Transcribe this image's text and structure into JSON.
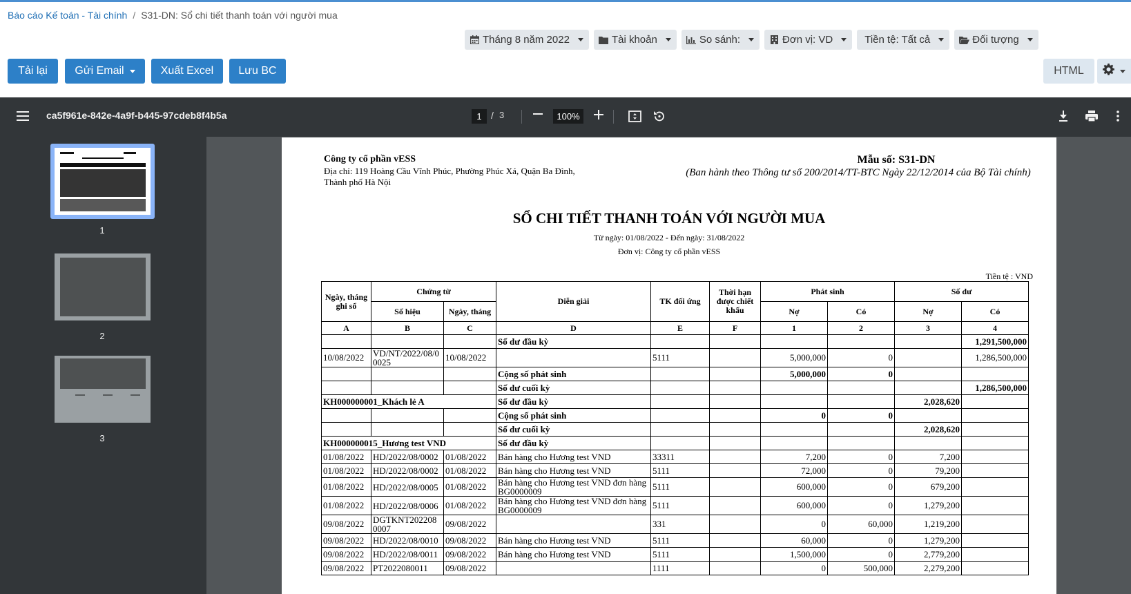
{
  "breadcrumb": {
    "parent": "Báo cáo Kế toán - Tài chính",
    "separator": "/",
    "current": "S31-DN: Sổ chi tiết thanh toán với người mua"
  },
  "filters": [
    {
      "icon": "calendar-icon",
      "label": "Tháng 8 năm 2022"
    },
    {
      "icon": "folder-icon",
      "label": "Tài khoản"
    },
    {
      "icon": "bar-chart-icon",
      "label": "So sánh:"
    },
    {
      "icon": "building-icon",
      "label": "Đơn vị: VD"
    },
    {
      "icon": "",
      "label": "Tiền tệ: Tất cả"
    },
    {
      "icon": "folder-open-icon",
      "label": "Đối tượng"
    }
  ],
  "toolbar": {
    "reload": "Tải lại",
    "send_email": "Gửi Email",
    "export_excel": "Xuất Excel",
    "save_report": "Lưu BC",
    "html": "HTML"
  },
  "viewer": {
    "file_name": "ca5f961e-842e-4a9f-b445-97cdeb8f4b5a",
    "current_page": "1",
    "page_separator": "/",
    "total_pages": "3",
    "zoom": "100%",
    "thumbnails": [
      "1",
      "2",
      "3"
    ]
  },
  "report": {
    "company": "Công ty cổ phần vESS",
    "address": "Địa chỉ: 119 Hoàng Cầu Vĩnh Phúc, Phường Phúc Xá, Quận Ba Đình, Thành phố Hà Nội",
    "form_no": "Mẫu số: S31-DN",
    "form_note": "(Ban hành theo Thông tư số 200/2014/TT-BTC Ngày 22/12/2014 của Bộ Tài chính)",
    "title": "SỔ CHI TIẾT THANH TOÁN VỚI NGƯỜI MUA",
    "date_range": "Từ ngày: 01/08/2022 - Đến ngày: 31/08/2022",
    "unit": "Đơn vị: Công ty cổ phần vESS",
    "currency": "Tiền tệ : VND",
    "headers": {
      "date_recorded": "Ngày, tháng ghi sổ",
      "voucher": "Chứng từ",
      "voucher_no": "Số hiệu",
      "voucher_date": "Ngày, tháng",
      "description": "Diễn giải",
      "contra_account": "TK đối ứng",
      "discount_period": "Thời hạn được chiết khấu",
      "arising": "Phát sinh",
      "balance": "Số dư",
      "debit": "Nợ",
      "credit": "Có"
    },
    "code_row": [
      "A",
      "B",
      "C",
      "D",
      "E",
      "F",
      "1",
      "2",
      "3",
      "4"
    ],
    "rows": [
      {
        "kind": "summary",
        "date": "",
        "no": "",
        "vdate": "",
        "desc": "Số dư đầu kỳ",
        "acc": "",
        "term": "",
        "debit": "",
        "credit": "",
        "bal_debit": "",
        "bal_credit": "1,291,500,000"
      },
      {
        "kind": "detail",
        "date": "10/08/2022",
        "no": "VD/NT/2022/08/0 0025",
        "vdate": "10/08/2022",
        "desc": "",
        "acc": "5111",
        "term": "",
        "debit": "5,000,000",
        "credit": "0",
        "bal_debit": "",
        "bal_credit": "1,286,500,000"
      },
      {
        "kind": "summary",
        "date": "",
        "no": "",
        "vdate": "",
        "desc": "Cộng số phát sinh",
        "acc": "",
        "term": "",
        "debit": "5,000,000",
        "credit": "0",
        "bal_debit": "",
        "bal_credit": ""
      },
      {
        "kind": "summary",
        "date": "",
        "no": "",
        "vdate": "",
        "desc": "Số dư cuối kỳ",
        "acc": "",
        "term": "",
        "debit": "",
        "credit": "",
        "bal_debit": "",
        "bal_credit": "1,286,500,000"
      },
      {
        "kind": "group",
        "group": "KH000000001_Khách lẻ A",
        "desc": "Số dư đầu kỳ",
        "acc": "",
        "term": "",
        "debit": "",
        "credit": "",
        "bal_debit": "2,028,620",
        "bal_credit": ""
      },
      {
        "kind": "summary",
        "date": "",
        "no": "",
        "vdate": "",
        "desc": "Cộng số phát sinh",
        "acc": "",
        "term": "",
        "debit": "0",
        "credit": "0",
        "bal_debit": "",
        "bal_credit": ""
      },
      {
        "kind": "summary",
        "date": "",
        "no": "",
        "vdate": "",
        "desc": "Số dư cuối kỳ",
        "acc": "",
        "term": "",
        "debit": "",
        "credit": "",
        "bal_debit": "2,028,620",
        "bal_credit": ""
      },
      {
        "kind": "group",
        "group": "KH000000015_Hương test VND",
        "desc": "Số dư đầu kỳ",
        "acc": "",
        "term": "",
        "debit": "",
        "credit": "",
        "bal_debit": "",
        "bal_credit": ""
      },
      {
        "kind": "detail",
        "date": "01/08/2022",
        "no": "HD/2022/08/0002",
        "vdate": "01/08/2022",
        "desc": "Bán hàng cho Hương test VND",
        "acc": "33311",
        "term": "",
        "debit": "7,200",
        "credit": "0",
        "bal_debit": "7,200",
        "bal_credit": ""
      },
      {
        "kind": "detail",
        "date": "01/08/2022",
        "no": "HD/2022/08/0002",
        "vdate": "01/08/2022",
        "desc": "Bán hàng cho Hương test VND",
        "acc": "5111",
        "term": "",
        "debit": "72,000",
        "credit": "0",
        "bal_debit": "79,200",
        "bal_credit": ""
      },
      {
        "kind": "detail",
        "date": "01/08/2022",
        "no": "HD/2022/08/0005",
        "vdate": "01/08/2022",
        "desc": "Bán hàng cho Hương test VND đơn hàng BG0000009",
        "acc": "5111",
        "term": "",
        "debit": "600,000",
        "credit": "0",
        "bal_debit": "679,200",
        "bal_credit": ""
      },
      {
        "kind": "detail",
        "date": "01/08/2022",
        "no": "HD/2022/08/0006",
        "vdate": "01/08/2022",
        "desc": "Bán hàng cho Hương test VND đơn hàng BG0000009",
        "acc": "5111",
        "term": "",
        "debit": "600,000",
        "credit": "0",
        "bal_debit": "1,279,200",
        "bal_credit": ""
      },
      {
        "kind": "detail",
        "date": "09/08/2022",
        "no": "DGTKNT202208 0007",
        "vdate": "09/08/2022",
        "desc": "",
        "acc": "331",
        "term": "",
        "debit": "0",
        "credit": "60,000",
        "bal_debit": "1,219,200",
        "bal_credit": ""
      },
      {
        "kind": "detail",
        "date": "09/08/2022",
        "no": "HD/2022/08/0010",
        "vdate": "09/08/2022",
        "desc": "Bán hàng cho Hương test VND",
        "acc": "5111",
        "term": "",
        "debit": "60,000",
        "credit": "0",
        "bal_debit": "1,279,200",
        "bal_credit": ""
      },
      {
        "kind": "detail",
        "date": "09/08/2022",
        "no": "HD/2022/08/0011",
        "vdate": "09/08/2022",
        "desc": "Bán hàng cho Hương test VND",
        "acc": "5111",
        "term": "",
        "debit": "1,500,000",
        "credit": "0",
        "bal_debit": "2,779,200",
        "bal_credit": ""
      },
      {
        "kind": "detail",
        "date": "09/08/2022",
        "no": "PT2022080011",
        "vdate": "09/08/2022",
        "desc": "",
        "acc": "1111",
        "term": "",
        "debit": "0",
        "credit": "500,000",
        "bal_debit": "2,279,200",
        "bal_credit": ""
      }
    ]
  }
}
